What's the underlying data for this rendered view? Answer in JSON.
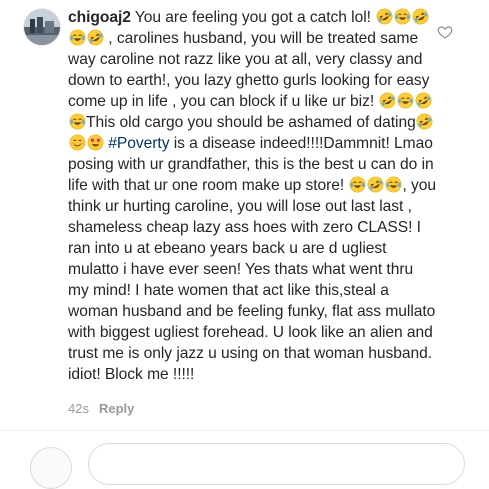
{
  "comment": {
    "username": "chigoaj2",
    "segments": [
      {
        "type": "text",
        "value": " You are feeling you got a catch lol! "
      },
      {
        "type": "emoji",
        "name": "rofl"
      },
      {
        "type": "emoji",
        "name": "joy"
      },
      {
        "type": "emoji",
        "name": "rofl"
      },
      {
        "type": "emoji",
        "name": "joy"
      },
      {
        "type": "emoji",
        "name": "rofl"
      },
      {
        "type": "text",
        "value": " , carolines husband, you will be treated same way caroline not razz like you at all, very classy and down to earth!, you lazy ghetto  gurls looking for easy come up in life , you can block if u like ur biz! "
      },
      {
        "type": "emoji",
        "name": "rofl"
      },
      {
        "type": "emoji",
        "name": "joy"
      },
      {
        "type": "emoji",
        "name": "rofl"
      },
      {
        "type": "emoji",
        "name": "joy"
      },
      {
        "type": "text",
        "value": "This old cargo you should be ashamed of dating"
      },
      {
        "type": "emoji",
        "name": "rofl"
      },
      {
        "type": "emoji",
        "name": "blush"
      },
      {
        "type": "emoji",
        "name": "heart-eyes"
      },
      {
        "type": "text",
        "value": " "
      },
      {
        "type": "hashtag",
        "value": "#Poverty"
      },
      {
        "type": "text",
        "value": " is a disease indeed!!!!Dammnit! Lmao posing with ur grandfather, this is the best u can do in life with that ur one room make up store! "
      },
      {
        "type": "emoji",
        "name": "joy"
      },
      {
        "type": "emoji",
        "name": "rofl"
      },
      {
        "type": "emoji",
        "name": "joy"
      },
      {
        "type": "text",
        "value": ", you think ur hurting caroline, you will lose out last last , shameless cheap lazy ass hoes with zero CLASS! I ran into u at ebeano years back u are d ugliest mulatto i have ever seen! Yes thats what went thru my mind! I hate women that act like this,steal a woman husband and be feeling funky, flat ass mullato with biggest ugliest forehead. U look like an alien and trust me is only jazz u using on that woman husband. idiot! Block me !!!!!"
      }
    ],
    "timestamp": "42s",
    "reply_label": "Reply"
  },
  "colors": {
    "text": "#262626",
    "hashtag": "#003569",
    "meta": "#999999",
    "emoji_face": "#FFCC33",
    "tear": "#5DADEC",
    "heart": "#E0245E"
  },
  "icons": {
    "like": "heart-outline-icon",
    "avatar": "profile-avatar"
  }
}
